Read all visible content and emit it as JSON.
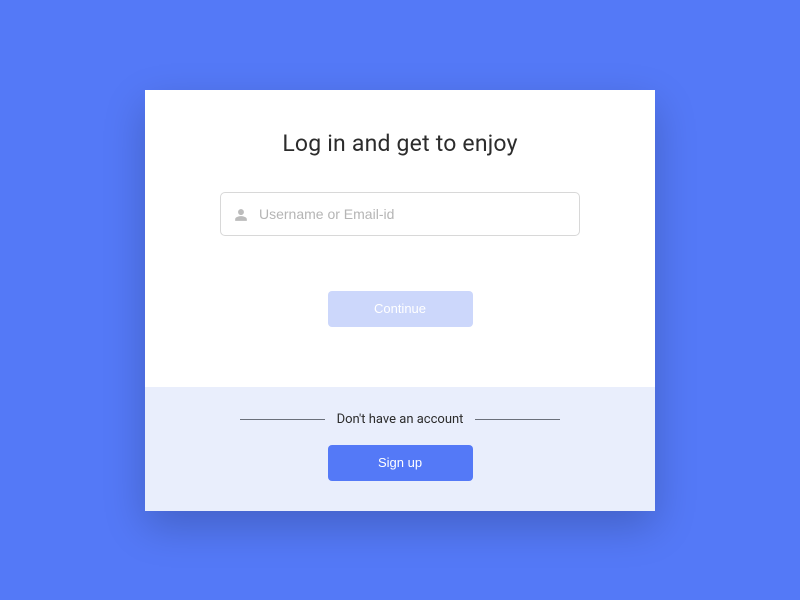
{
  "title": "Log in and get to enjoy",
  "form": {
    "username_placeholder": "Username or Email-id",
    "continue_label": "Continue"
  },
  "footer": {
    "prompt": "Don't have an account",
    "signup_label": "Sign up"
  }
}
